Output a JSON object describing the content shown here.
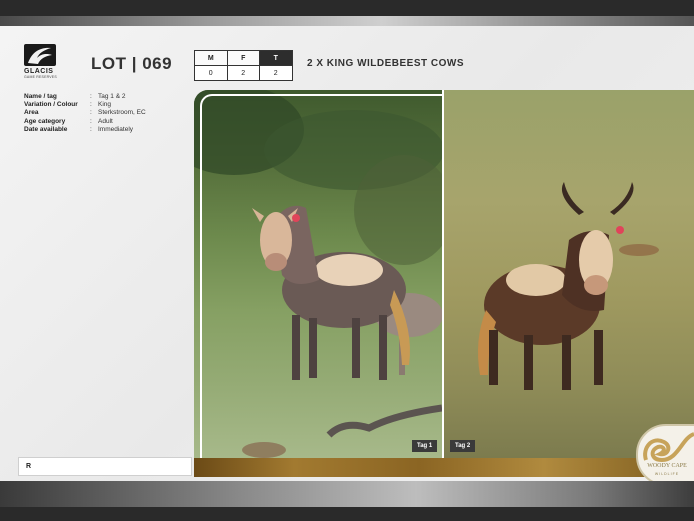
{
  "header": {
    "logo_name": "GLACIS",
    "logo_sub": "GAME RESERVES",
    "lot_title": "LOT | 069",
    "lot_description": "2 X KING WILDEBEEST COWS"
  },
  "counts": {
    "headers": [
      "M",
      "F",
      "T"
    ],
    "values": [
      "0",
      "2",
      "2"
    ]
  },
  "details": [
    {
      "key": "Name / tag",
      "value": "Tag 1 & 2"
    },
    {
      "key": "Variation / Colour",
      "value": "King"
    },
    {
      "key": "Area",
      "value": "Sterkstroom, EC"
    },
    {
      "key": "Age category",
      "value": "Adult"
    },
    {
      "key": "Date available",
      "value": "Immediately"
    }
  ],
  "photos": {
    "tag1": "Tag 1",
    "tag2": "Tag 2"
  },
  "search": {
    "value": "R"
  },
  "brand": {
    "name": "WOODY CAPE",
    "sub": "WILDLIFE"
  },
  "colors": {
    "dark": "#2d2d2d",
    "wood": "#a27a30",
    "brand_gold": "#8a7a47"
  }
}
